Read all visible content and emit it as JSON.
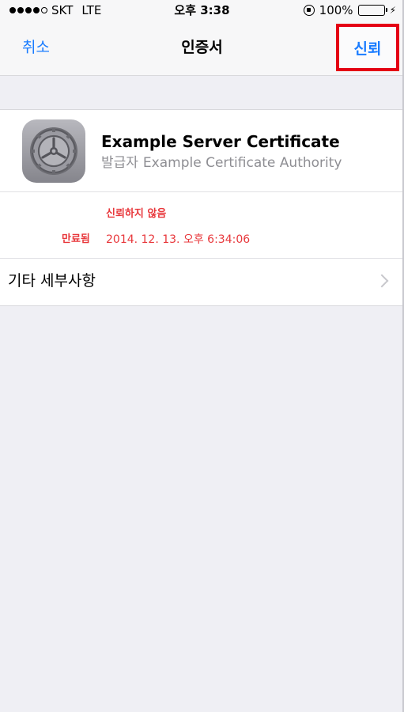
{
  "status_bar": {
    "carrier": "SKT",
    "network": "LTE",
    "time": "오후 3:38",
    "battery": "100%",
    "battery_level": 1.0
  },
  "nav": {
    "cancel_label": "취소",
    "title": "인증서",
    "trust_label": "신뢰"
  },
  "certificate": {
    "icon": "settings-gear-icon",
    "name": "Example Server Certificate",
    "issuer_label": "발급자",
    "issuer": "Example Certificate Authority",
    "trust_status": "신뢰하지 않음",
    "expires_label": "만료됨",
    "expires_value": "2014. 12. 13. 오후 6:34:06"
  },
  "details": {
    "more_label": "기타 세부사항"
  },
  "colors": {
    "accent": "#1a7cff",
    "warning": "#e8383c",
    "highlight_box": "#e40014",
    "background": "#efeff4"
  }
}
